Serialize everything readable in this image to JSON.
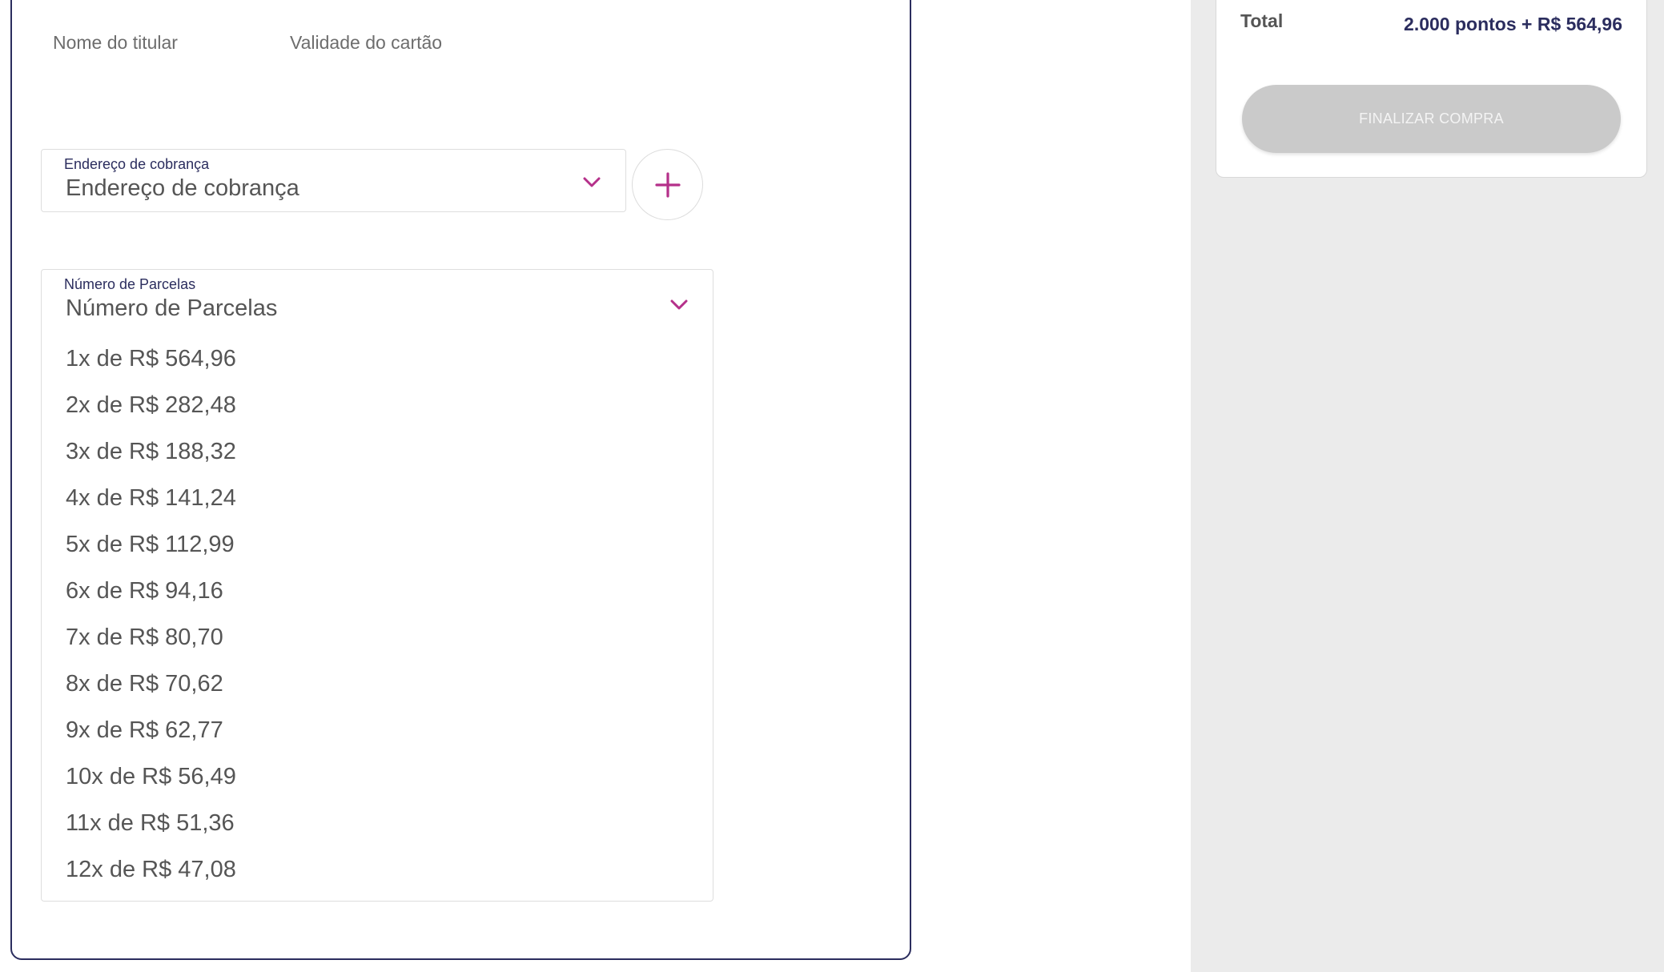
{
  "payment_form": {
    "holder_name_label": "Nome do titular",
    "card_validity_label": "Validade do cartão",
    "billing_address": {
      "floating_label": "Endereço de cobrança",
      "value": "Endereço de cobrança"
    },
    "installments": {
      "floating_label": "Número de Parcelas",
      "value": "Número de Parcelas",
      "options": [
        "1x de R$ 564,96",
        "2x de R$ 282,48",
        "3x de R$ 188,32",
        "4x de R$ 141,24",
        "5x de R$ 112,99",
        "6x de R$ 94,16",
        "7x de R$ 80,70",
        "8x de R$ 70,62",
        "9x de R$ 62,77",
        "10x de R$ 56,49",
        "11x de R$ 51,36",
        "12x de R$ 47,08"
      ]
    }
  },
  "summary": {
    "total_label": "Total",
    "total_value": "2.000 pontos + R$ 564,96",
    "finalize_label": "FINALIZAR COMPRA"
  },
  "icons": {
    "chevron": "chevron-down-icon",
    "add": "plus-icon"
  },
  "colors": {
    "accent": "#b5308a",
    "brand_navy": "#2b2d5e",
    "disabled_button": "#cacaca"
  }
}
